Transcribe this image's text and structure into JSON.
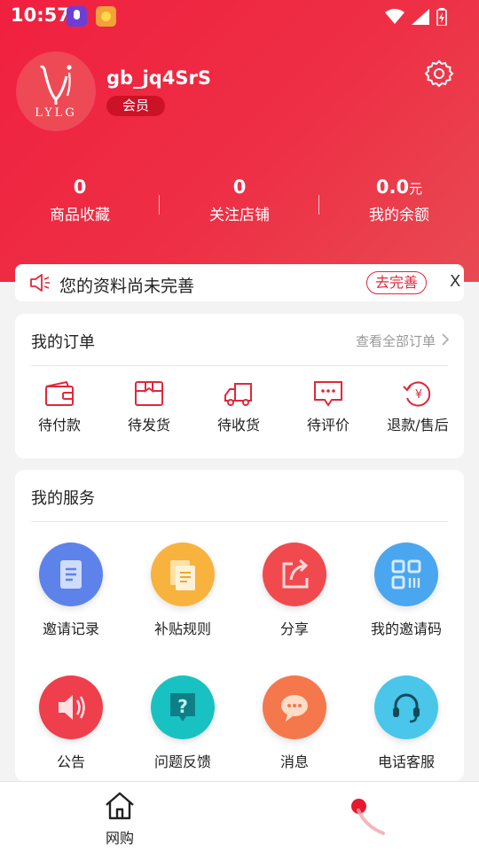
{
  "status_bar": {
    "time": "10:57"
  },
  "profile": {
    "avatar_text": "LYLG",
    "username": "gb_jq4SrS",
    "member_badge": "会员"
  },
  "stats": [
    {
      "value": "0",
      "unit": "",
      "label": "商品收藏"
    },
    {
      "value": "0",
      "unit": "",
      "label": "关注店铺"
    },
    {
      "value": "0.0",
      "unit": "元",
      "label": "我的余额"
    }
  ],
  "notice": {
    "text": "您的资料尚未完善",
    "button": "去完善",
    "close": "X"
  },
  "orders": {
    "title": "我的订单",
    "view_all": "查看全部订单",
    "items": [
      {
        "label": "待付款",
        "icon": "wallet-icon"
      },
      {
        "label": "待发货",
        "icon": "box-icon"
      },
      {
        "label": "待收货",
        "icon": "truck-icon"
      },
      {
        "label": "待评价",
        "icon": "comment-icon"
      },
      {
        "label": "退款/售后",
        "icon": "refund-icon"
      }
    ]
  },
  "services": {
    "title": "我的服务",
    "items": [
      {
        "label": "邀请记录",
        "icon": "document-icon",
        "color": "#5d82ea"
      },
      {
        "label": "补贴规则",
        "icon": "notes-icon",
        "color": "#f8b23e"
      },
      {
        "label": "分享",
        "icon": "share-icon",
        "color": "#f14a4e"
      },
      {
        "label": "我的邀请码",
        "icon": "qrcode-icon",
        "color": "#4aa6ef"
      },
      {
        "label": "公告",
        "icon": "speaker-icon",
        "color": "#ef3e4c"
      },
      {
        "label": "问题反馈",
        "icon": "question-icon",
        "color": "#19c2c2"
      },
      {
        "label": "消息",
        "icon": "chat-icon",
        "color": "#f4784c"
      },
      {
        "label": "电话客服",
        "icon": "headset-icon",
        "color": "#49c6ea"
      }
    ]
  },
  "bottom_nav": {
    "home_label": "网购"
  },
  "colors": {
    "brand": "#ee2a40",
    "accent": "#e0283c"
  }
}
